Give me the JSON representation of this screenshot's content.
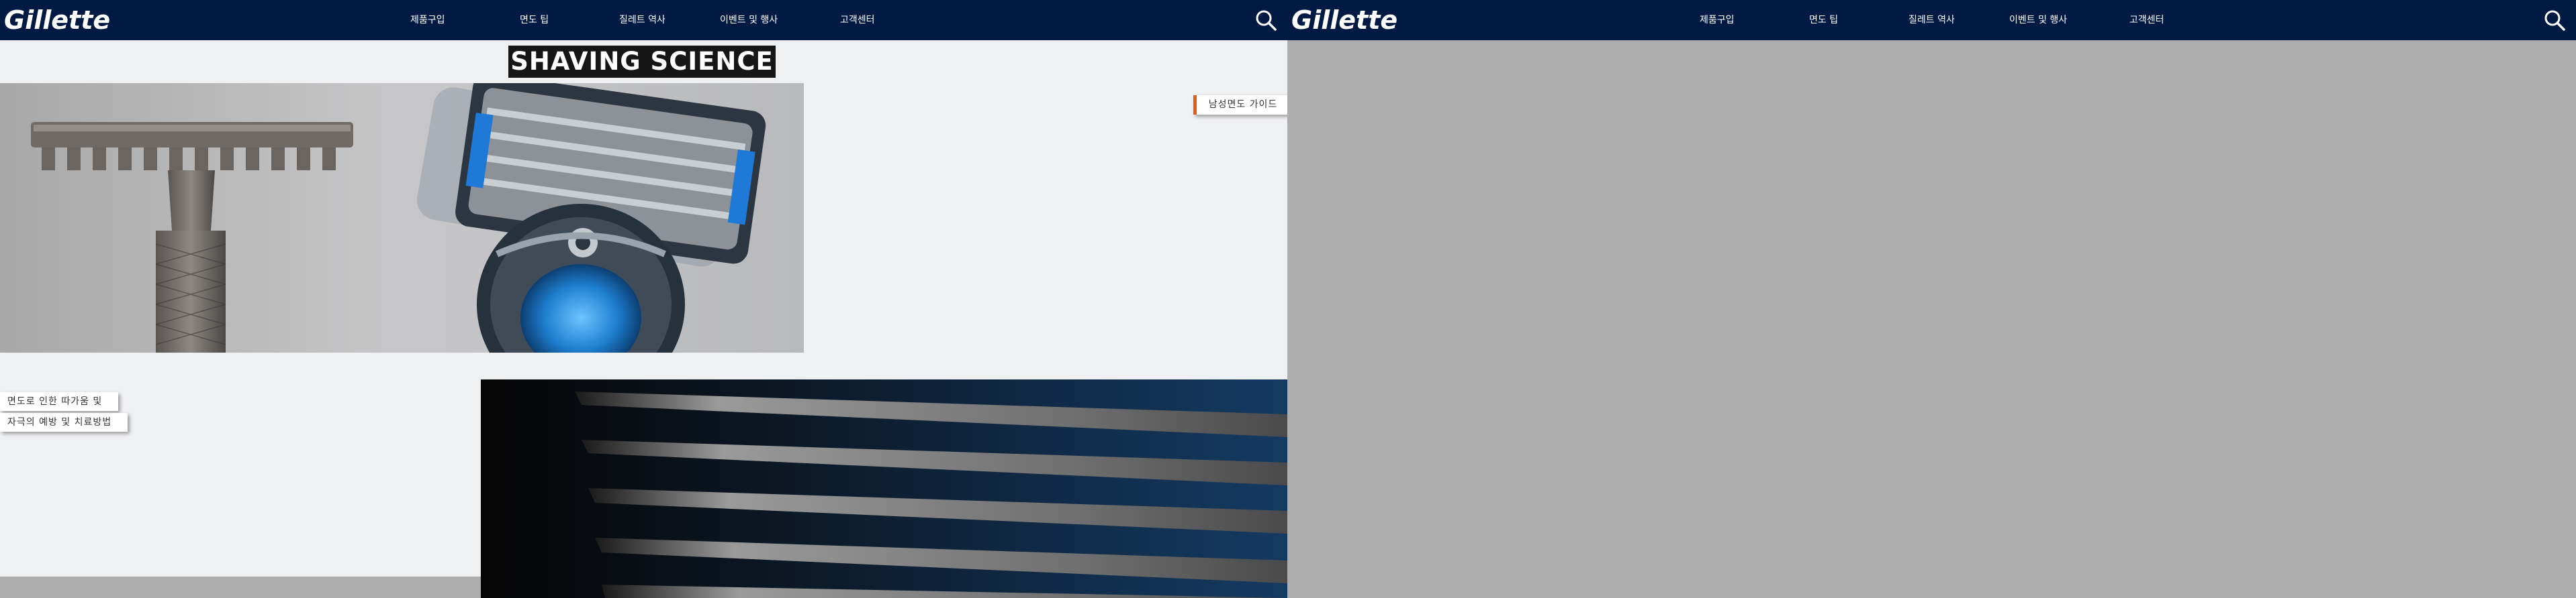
{
  "nav": {
    "logo_text": "Gillette",
    "items": [
      "제품구입",
      "면도 팁",
      "질레트 역사",
      "이벤트 및 행사",
      "고객센터"
    ]
  },
  "content": {
    "title": "SHAVING SCIENCE",
    "guide_tag": "남성면도 가이드",
    "irritation_tag_line1": "면도로 인한 따가움 및",
    "irritation_tag_line2": "자극의 예방 및 치료방법"
  },
  "colors": {
    "nav_bg": "#001a44",
    "page_bg": "#eff0f2",
    "overlay_bg": "#adadad",
    "accent": "#e55b12",
    "title_bg": "#161616"
  },
  "icons": [
    "search-icon",
    "gillette-logo"
  ]
}
